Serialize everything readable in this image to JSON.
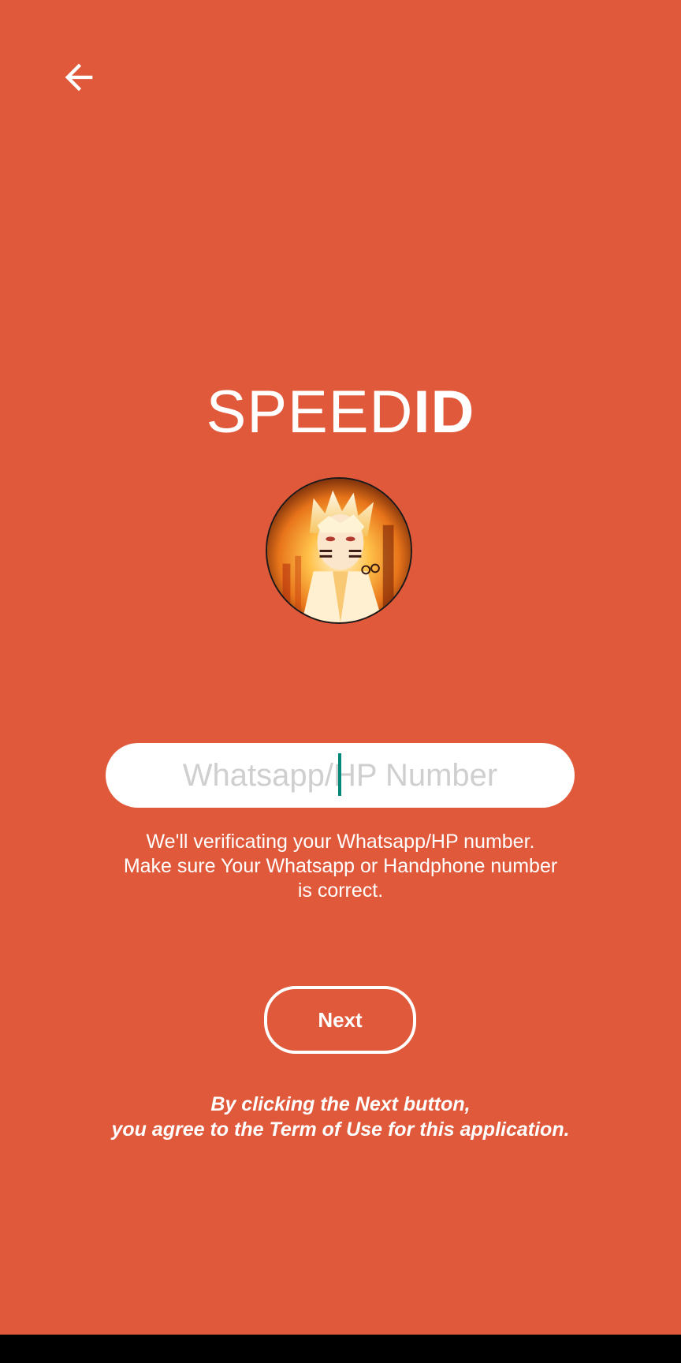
{
  "colors": {
    "background": "#E0593B",
    "text": "#FFFFFF",
    "input_background": "#FFFFFF",
    "placeholder": "#CFCFCF",
    "caret": "#00897B",
    "nav_bar": "#000000"
  },
  "header": {
    "back_icon": "arrow-left-icon"
  },
  "brand": {
    "title_light": "SPEED",
    "title_bold": "ID"
  },
  "avatar": {
    "icon": "profile-avatar"
  },
  "form": {
    "phone_placeholder": "Whatsapp/HP Number",
    "phone_value": "",
    "helper_lines": [
      "We'll verificating your Whatsapp/HP number.",
      "Make sure Your Whatsapp or Handphone number",
      "is correct."
    ],
    "next_label": "Next"
  },
  "terms": {
    "lines": [
      "By clicking the Next button,",
      "you agree to the Term of Use for this application."
    ]
  }
}
